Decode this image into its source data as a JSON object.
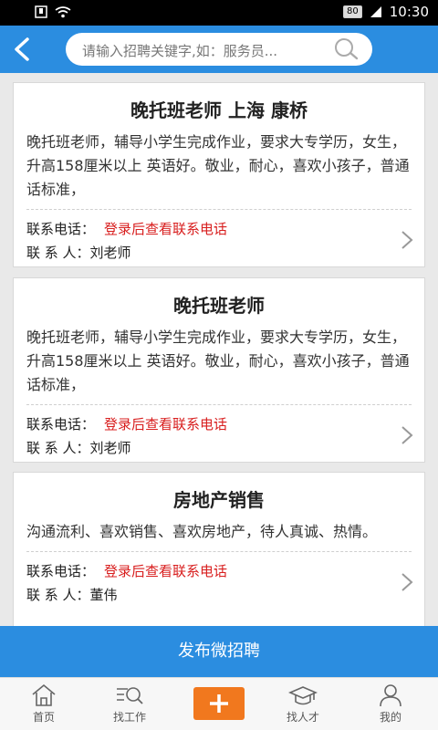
{
  "status_bar": {
    "battery": "80",
    "time": "10:30"
  },
  "header": {
    "search_placeholder": "请输入招聘关键字,如：服务员..."
  },
  "jobs": [
    {
      "title": "晚托班老师 上海 康桥",
      "description": "晚托班老师，辅导小学生完成作业，要求大专学历，女生，升高158厘米以上 英语好。敬业，耐心，喜欢小孩子，普通话标准，",
      "phone_label": "联系电话：",
      "phone_value": "登录后查看联系电话",
      "contact_label": "联  系  人：",
      "contact_value": "刘老师"
    },
    {
      "title": "晚托班老师",
      "description": "晚托班老师，辅导小学生完成作业，要求大专学历，女生，升高158厘米以上 英语好。敬业，耐心，喜欢小孩子，普通话标准，",
      "phone_label": "联系电话：",
      "phone_value": "登录后查看联系电话",
      "contact_label": "联  系  人：",
      "contact_value": "刘老师"
    },
    {
      "title": "房地产销售",
      "description": "沟通流利、喜欢销售、喜欢房地产，待人真诚、热情。",
      "phone_label": "联系电话：",
      "phone_value": "登录后查看联系电话",
      "contact_label": "联  系  人：",
      "contact_value": "董伟"
    }
  ],
  "publish_label": "发布微招聘",
  "nav": {
    "home": "首页",
    "find_job": "找工作",
    "find_talent": "找人才",
    "mine": "我的"
  },
  "colors": {
    "primary": "#2b8de0",
    "accent": "#f1781e",
    "highlight": "#d81e1e"
  }
}
